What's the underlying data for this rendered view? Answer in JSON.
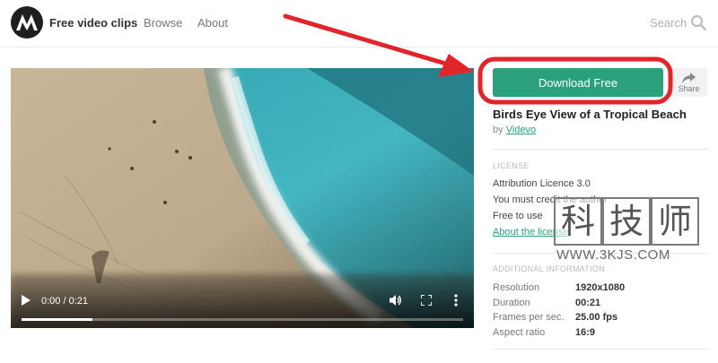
{
  "header": {
    "brand": "Free video clips",
    "nav": [
      "Browse",
      "About"
    ],
    "search_placeholder": "Search"
  },
  "video": {
    "current_time": "0:00",
    "duration": "0:21",
    "time_separator": "/",
    "progress_fraction": 0.16
  },
  "panel": {
    "download_label": "Download Free",
    "share_label": "Share",
    "title": "Birds Eye View of a Tropical Beach",
    "by_prefix": "by",
    "author": "Videvo",
    "license_heading": "LICENSE",
    "license_lines": [
      "Attribution Licence 3.0",
      "You must credit the author",
      "Free to use"
    ],
    "license_link": "About the license",
    "info_heading": "ADDITIONAL INFORMATION",
    "info": [
      {
        "key": "Resolution",
        "value": "1920x1080"
      },
      {
        "key": "Duration",
        "value": "00:21"
      },
      {
        "key": "Frames per sec.",
        "value": "25.00 fps"
      },
      {
        "key": "Aspect ratio",
        "value": "16:9"
      }
    ]
  },
  "watermark": {
    "chars": [
      "科",
      "技",
      "师"
    ],
    "url": "WWW.3KJS.COM"
  },
  "colors": {
    "accent_green": "#2aa17c",
    "annotation_red": "#e0262b",
    "logo_bg": "#1f1f1f"
  }
}
